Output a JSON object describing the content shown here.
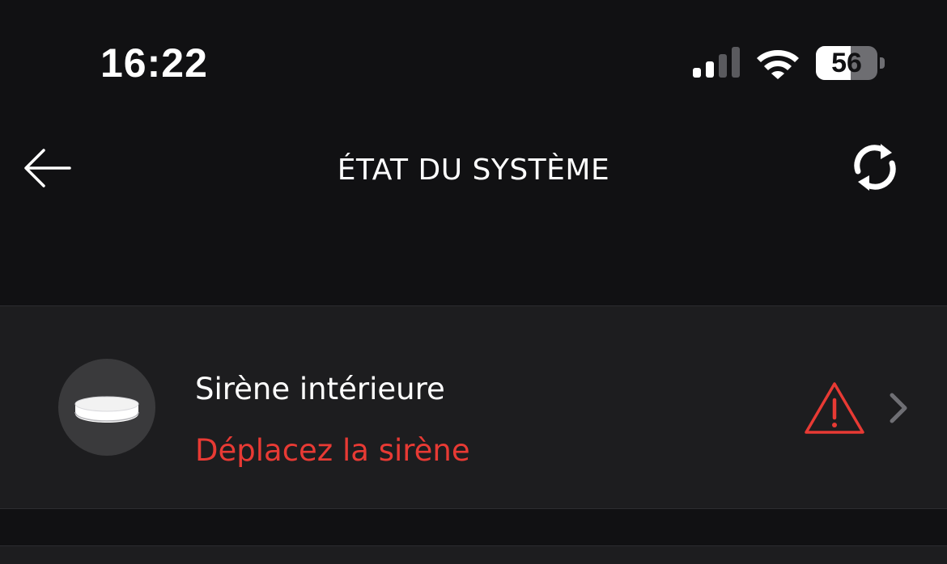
{
  "status_bar": {
    "time": "16:22",
    "battery_level": "56",
    "battery_fraction": 0.56,
    "signal_bars_active": 2,
    "signal_bars_total": 4
  },
  "nav": {
    "title": "ÉTAT DU SYSTÈME",
    "back_icon": "arrow-left-icon",
    "refresh_icon": "refresh-icon"
  },
  "devices": [
    {
      "name": "Sirène intérieure",
      "status": "Déplacez la sirène",
      "status_icon": "warning-triangle-icon",
      "device_icon": "siren-puck-icon"
    }
  ],
  "colors": {
    "background": "#111113",
    "row_background": "#1d1d1f",
    "accent_red": "#e83a34",
    "text_primary": "#ffffff",
    "chevron": "#6f6f74",
    "avatar": "#3a3a3c"
  }
}
